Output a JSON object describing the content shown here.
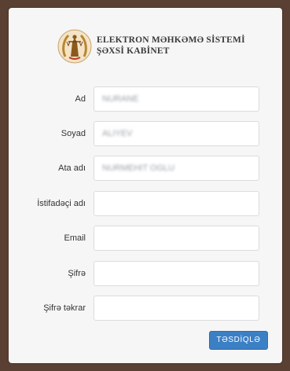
{
  "header": {
    "title_line1": "ELEKTRON MƏHKƏMƏ SİSTEMİ",
    "title_line2": "ŞƏXSİ KABİNET",
    "logo_icon": "themis-scales-emblem-icon"
  },
  "form": {
    "fields": [
      {
        "label": "Ad",
        "value": "NURANE"
      },
      {
        "label": "Soyad",
        "value": "ALIYEV"
      },
      {
        "label": "Ata adı",
        "value": "NURMEHIT OGLU"
      },
      {
        "label": "İstifadəçi adı",
        "value": ""
      },
      {
        "label": "Email",
        "value": ""
      },
      {
        "label": "Şifrə",
        "value": ""
      },
      {
        "label": "Şifrə təkrar",
        "value": ""
      }
    ],
    "submit_label": "TƏSDİQLƏ"
  },
  "colors": {
    "background": "#5a3f33",
    "card": "#f6f6f6",
    "button": "#3b7fc4"
  }
}
